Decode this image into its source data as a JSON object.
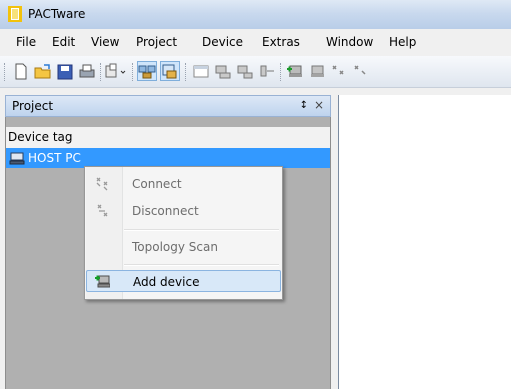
{
  "window": {
    "title": "PACTware"
  },
  "menu": [
    "File",
    "Edit",
    "View",
    "Project",
    "Device",
    "Extras",
    "Window",
    "Help"
  ],
  "toolbar": {
    "icons": [
      "new-document-icon",
      "open-folder-icon",
      "save-icon",
      "print-icon",
      "device-catalog-icon",
      "project-view-icon",
      "device-catalog-toggle-icon",
      "window-icon",
      "connect-device-icon",
      "disconnect-device-icon",
      "topology-icon",
      "add-device-icon",
      "remove-device-icon",
      "device-tree-icon",
      "device-extra-icon"
    ]
  },
  "project_panel": {
    "title": "Project",
    "pin_glyph": "↕",
    "close_glyph": "×",
    "column_header": "Device tag",
    "tree": [
      {
        "label": "HOST PC",
        "icon": "host-pc-icon",
        "selected": true
      }
    ]
  },
  "context_menu": {
    "items": [
      {
        "label": "Connect",
        "icon": "connect-icon",
        "disabled": true
      },
      {
        "label": "Disconnect",
        "icon": "disconnect-icon",
        "disabled": true
      },
      {
        "label": "Topology Scan",
        "icon": "",
        "disabled": true
      },
      {
        "label": "Add device",
        "icon": "add-device-icon",
        "disabled": false,
        "highlighted": true
      }
    ]
  },
  "colors": {
    "selection": "#3399ff",
    "panel_bg": "#b0b0b0",
    "menu_highlight": "#d8e8f8"
  }
}
